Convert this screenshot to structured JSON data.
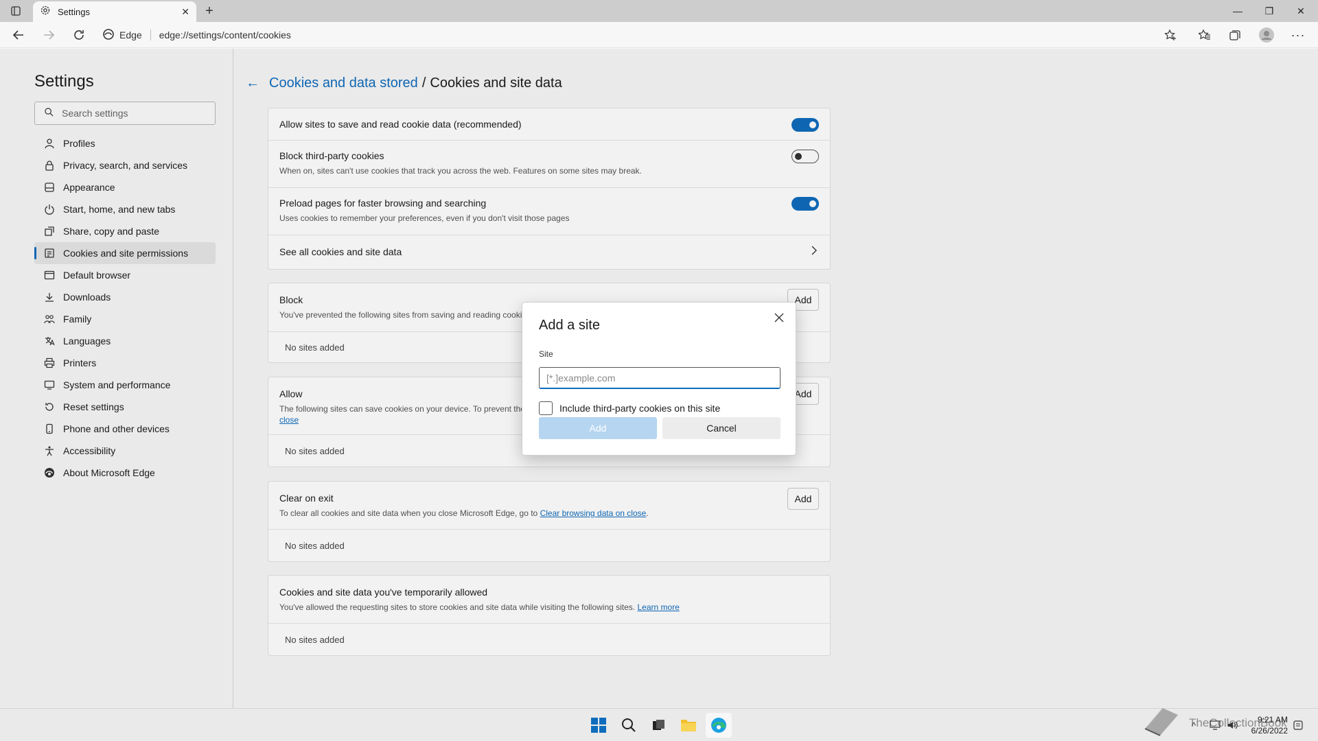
{
  "browser": {
    "tab_title": "Settings",
    "address_label": "Edge",
    "url": "edge://settings/content/cookies"
  },
  "sidebar": {
    "title": "Settings",
    "search_placeholder": "Search settings",
    "items": [
      {
        "label": "Profiles",
        "icon": "profile-icon"
      },
      {
        "label": "Privacy, search, and services",
        "icon": "lock-icon"
      },
      {
        "label": "Appearance",
        "icon": "appearance-icon"
      },
      {
        "label": "Start, home, and new tabs",
        "icon": "power-icon"
      },
      {
        "label": "Share, copy and paste",
        "icon": "share-icon"
      },
      {
        "label": "Cookies and site permissions",
        "icon": "cookies-icon",
        "active": true
      },
      {
        "label": "Default browser",
        "icon": "browser-icon"
      },
      {
        "label": "Downloads",
        "icon": "download-icon"
      },
      {
        "label": "Family",
        "icon": "family-icon"
      },
      {
        "label": "Languages",
        "icon": "language-icon"
      },
      {
        "label": "Printers",
        "icon": "printer-icon"
      },
      {
        "label": "System and performance",
        "icon": "system-icon"
      },
      {
        "label": "Reset settings",
        "icon": "reset-icon"
      },
      {
        "label": "Phone and other devices",
        "icon": "phone-icon"
      },
      {
        "label": "Accessibility",
        "icon": "accessibility-icon"
      },
      {
        "label": "About Microsoft Edge",
        "icon": "edge-icon"
      }
    ]
  },
  "breadcrumb": {
    "parent": "Cookies and data stored",
    "separator": "/",
    "current": "Cookies and site data"
  },
  "settings_card": {
    "allow": {
      "label": "Allow sites to save and read cookie data (recommended)",
      "on": true
    },
    "block_third_party": {
      "label": "Block third-party cookies",
      "desc": "When on, sites can't use cookies that track you across the web. Features on some sites may break.",
      "on": false
    },
    "preload": {
      "label": "Preload pages for faster browsing and searching",
      "desc": "Uses cookies to remember your preferences, even if you don't visit those pages",
      "on": true
    },
    "see_all": {
      "label": "See all cookies and site data"
    }
  },
  "block_card": {
    "title": "Block",
    "desc": "You've prevented the following sites from saving and reading cooki",
    "add_label": "Add",
    "empty": "No sites added"
  },
  "allow_card": {
    "title": "Allow",
    "desc": "The following sites can save cookies on your device. To prevent the",
    "desc_link": "close",
    "add_label": "Add",
    "empty": "No sites added"
  },
  "clear_card": {
    "title": "Clear on exit",
    "desc": "To clear all cookies and site data when you close Microsoft Edge, go to",
    "desc_link": "Clear browsing data on close",
    "desc_end": ".",
    "add_label": "Add",
    "empty": "No sites added"
  },
  "temp_card": {
    "title": "Cookies and site data you've temporarily allowed",
    "desc": "You've allowed the requesting sites to store cookies and site data while visiting the following sites.",
    "desc_link": "Learn more",
    "empty": "No sites added"
  },
  "dialog": {
    "title": "Add a site",
    "field_label": "Site",
    "placeholder": "[*.]example.com",
    "checkbox_label": "Include third-party cookies on this site",
    "add_label": "Add",
    "cancel_label": "Cancel"
  },
  "taskbar": {
    "time": "9:21 AM",
    "date": "6/26/2022",
    "watermark_text": "TheCollectionBook"
  },
  "colors": {
    "accent": "#0f6cbd",
    "disabled_primary": "#b5d5f0"
  }
}
